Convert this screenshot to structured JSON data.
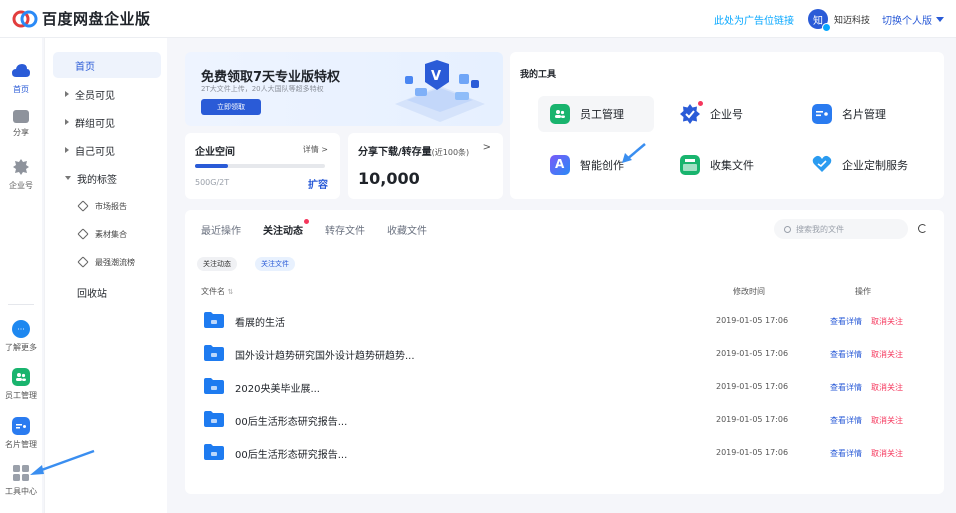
{
  "header": {
    "app_title": "百度网盘企业版",
    "ad_link": "此处为广告位链接",
    "avatar_char": "知",
    "org_name": "知迈科技",
    "switch_label": "切换个人版"
  },
  "rail": {
    "items": [
      {
        "label": "首页",
        "icon": "cloud-icon"
      },
      {
        "label": "分享",
        "icon": "folder-share-icon"
      },
      {
        "label": "企业号",
        "icon": "badge-icon"
      },
      {
        "label": "了解更多",
        "icon": "more-icon"
      },
      {
        "label": "员工管理",
        "icon": "staff-icon"
      },
      {
        "label": "名片管理",
        "icon": "card-icon"
      },
      {
        "label": "工具中心",
        "icon": "grid-icon"
      }
    ]
  },
  "nav": {
    "home": "首页",
    "all_visible": "全员可见",
    "group_visible": "群组可见",
    "self_visible": "自己可见",
    "my_tags": "我的标签",
    "tags": [
      "市场报告",
      "素材集合",
      "最强潮流榜"
    ],
    "recycle": "回收站"
  },
  "banner": {
    "title": "免费领取7天专业版特权",
    "subtitle": "2T大文件上传，20人大国队等超多特权",
    "button": "立即领取"
  },
  "space": {
    "title": "企业空间",
    "detail": "详情 >",
    "usage": "500G/2T",
    "usage_fraction": 0.25,
    "expand": "扩容"
  },
  "share": {
    "title": "分享下载/转存量",
    "range": "(近100条)",
    "chevron": ">",
    "value": "10,000"
  },
  "tools": {
    "title": "我的工具",
    "items": [
      {
        "label": "员工管理",
        "icon": "staff-icon",
        "color": "#19b46e"
      },
      {
        "label": "企业号",
        "icon": "verified-badge-icon",
        "color": "#2a5bd7"
      },
      {
        "label": "名片管理",
        "icon": "card-icon",
        "color": "#2a7bf0"
      },
      {
        "label": "智能创作",
        "icon": "ai-create-icon",
        "color": "#3d6cf5"
      },
      {
        "label": "收集文件",
        "icon": "inbox-icon",
        "color": "#19b46e"
      },
      {
        "label": "企业定制服务",
        "icon": "heart-service-icon",
        "color": "#2a9bf0"
      }
    ]
  },
  "main": {
    "tabs": [
      "最近操作",
      "关注动态",
      "转存文件",
      "收藏文件"
    ],
    "search_placeholder": "搜索我的文件",
    "chips": [
      "关注动态",
      "关注文件"
    ],
    "columns": {
      "name": "文件名",
      "modified": "修改时间",
      "action": "操作"
    },
    "rows": [
      {
        "name": "看展的生活",
        "time": "2019-01-05 17:06",
        "view": "查看详情",
        "unfollow": "取消关注"
      },
      {
        "name": "国外设计趋势研究国外设计趋势研趋势...",
        "time": "2019-01-05 17:06",
        "view": "查看详情",
        "unfollow": "取消关注"
      },
      {
        "name": "2020央美毕业展...",
        "time": "2019-01-05 17:06",
        "view": "查看详情",
        "unfollow": "取消关注"
      },
      {
        "name": "00后生活形态研究报告...",
        "time": "2019-01-05 17:06",
        "view": "查看详情",
        "unfollow": "取消关注"
      },
      {
        "name": "00后生活形态研究报告...",
        "time": "2019-01-05 17:06",
        "view": "查看详情",
        "unfollow": "取消关注"
      }
    ]
  },
  "colors": {
    "primary": "#2a5bd7",
    "link": "#06a7ff",
    "danger": "#f5365c",
    "folder": "#1e7bf0"
  }
}
